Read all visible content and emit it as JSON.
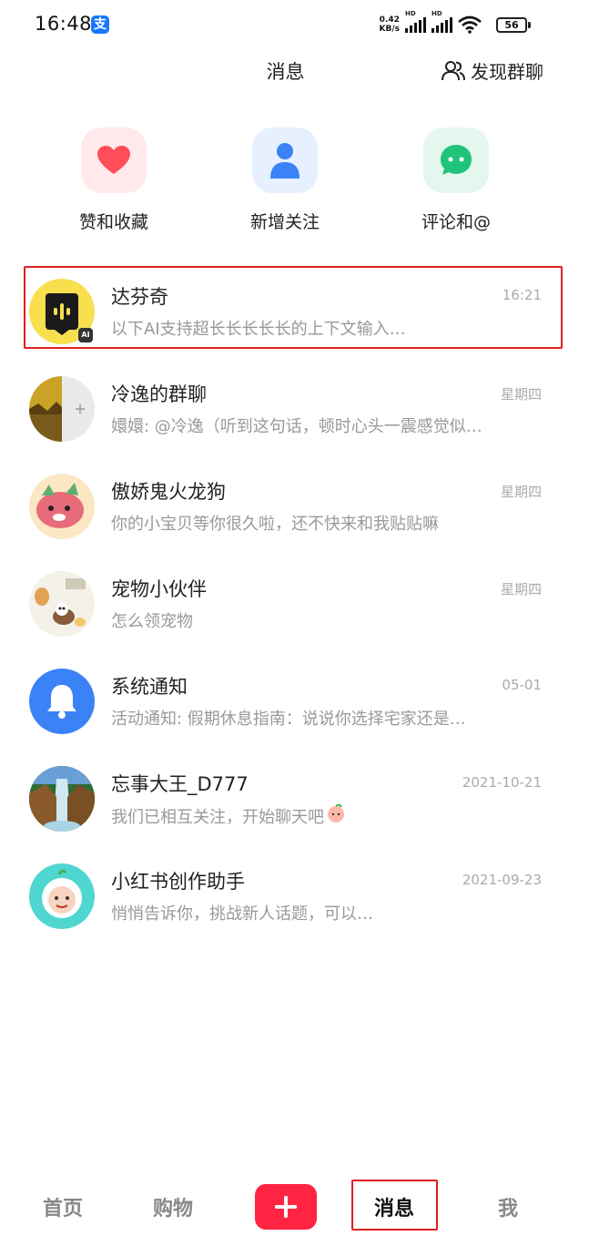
{
  "status_bar": {
    "time": "16:48",
    "app_icon": "alipay-icon",
    "net_speed_value": "0.42",
    "net_speed_unit": "KB/s",
    "signal_label": "HD",
    "battery": "56"
  },
  "header": {
    "title": "消息",
    "discover_label": "发现群聊",
    "discover_icon": "people-icon"
  },
  "quick_actions": [
    {
      "label": "赞和收藏",
      "icon": "heart-icon",
      "color": "#ff4d5a"
    },
    {
      "label": "新增关注",
      "icon": "person-icon",
      "color": "#3b82f6"
    },
    {
      "label": "评论和@",
      "icon": "chat-bubble-icon",
      "color": "#1fc37a"
    }
  ],
  "chats": [
    {
      "name": "达芬奇",
      "time": "16:21",
      "preview": "以下AI支持超长长长长长的上下文输入…",
      "badge": "AI"
    },
    {
      "name": "冷逸的群聊",
      "time": "星期四",
      "preview": "嬛嬛: @冷逸（听到这句话，顿时心头一震感觉似…"
    },
    {
      "name": "傲娇鬼火龙狗",
      "time": "星期四",
      "preview": "你的小宝贝等你很久啦，还不快来和我贴贴嘛"
    },
    {
      "name": "宠物小伙伴",
      "time": "星期四",
      "preview": "怎么领宠物"
    },
    {
      "name": "系统通知",
      "time": "05-01",
      "preview": "活动通知: 假期休息指南：说说你选择宅家还是…"
    },
    {
      "name": "忘事大王_D777",
      "time": "2021-10-21",
      "preview": "我们已相互关注，开始聊天吧"
    },
    {
      "name": "小红书创作助手",
      "time": "2021-09-23",
      "preview": "悄悄告诉你，挑战新人话题，可以…"
    }
  ],
  "bottom_nav": {
    "home": "首页",
    "shop": "购物",
    "plus_icon": "plus-icon",
    "messages": "消息",
    "me": "我",
    "accent": "#ff2442"
  }
}
